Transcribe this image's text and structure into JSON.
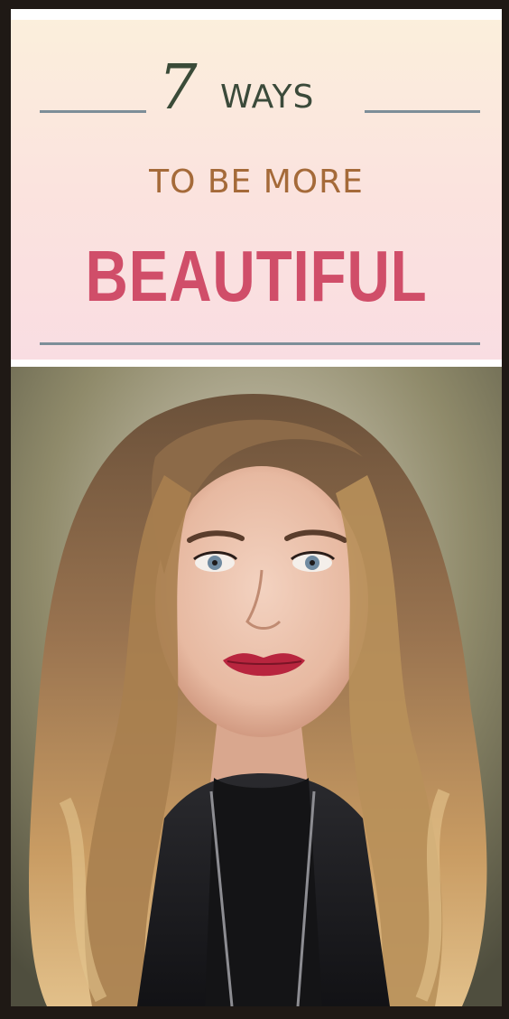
{
  "title": {
    "number": "7",
    "word": "WAYS",
    "line2": "TO BE MORE",
    "line3": "BEAUTIFUL"
  },
  "colors": {
    "number": "#3a4b38",
    "line2": "#a56a39",
    "line3": "#d04e69",
    "rules": "#7d8e98"
  },
  "photo": {
    "subject": "portrait-woman-long-wavy-hair"
  }
}
